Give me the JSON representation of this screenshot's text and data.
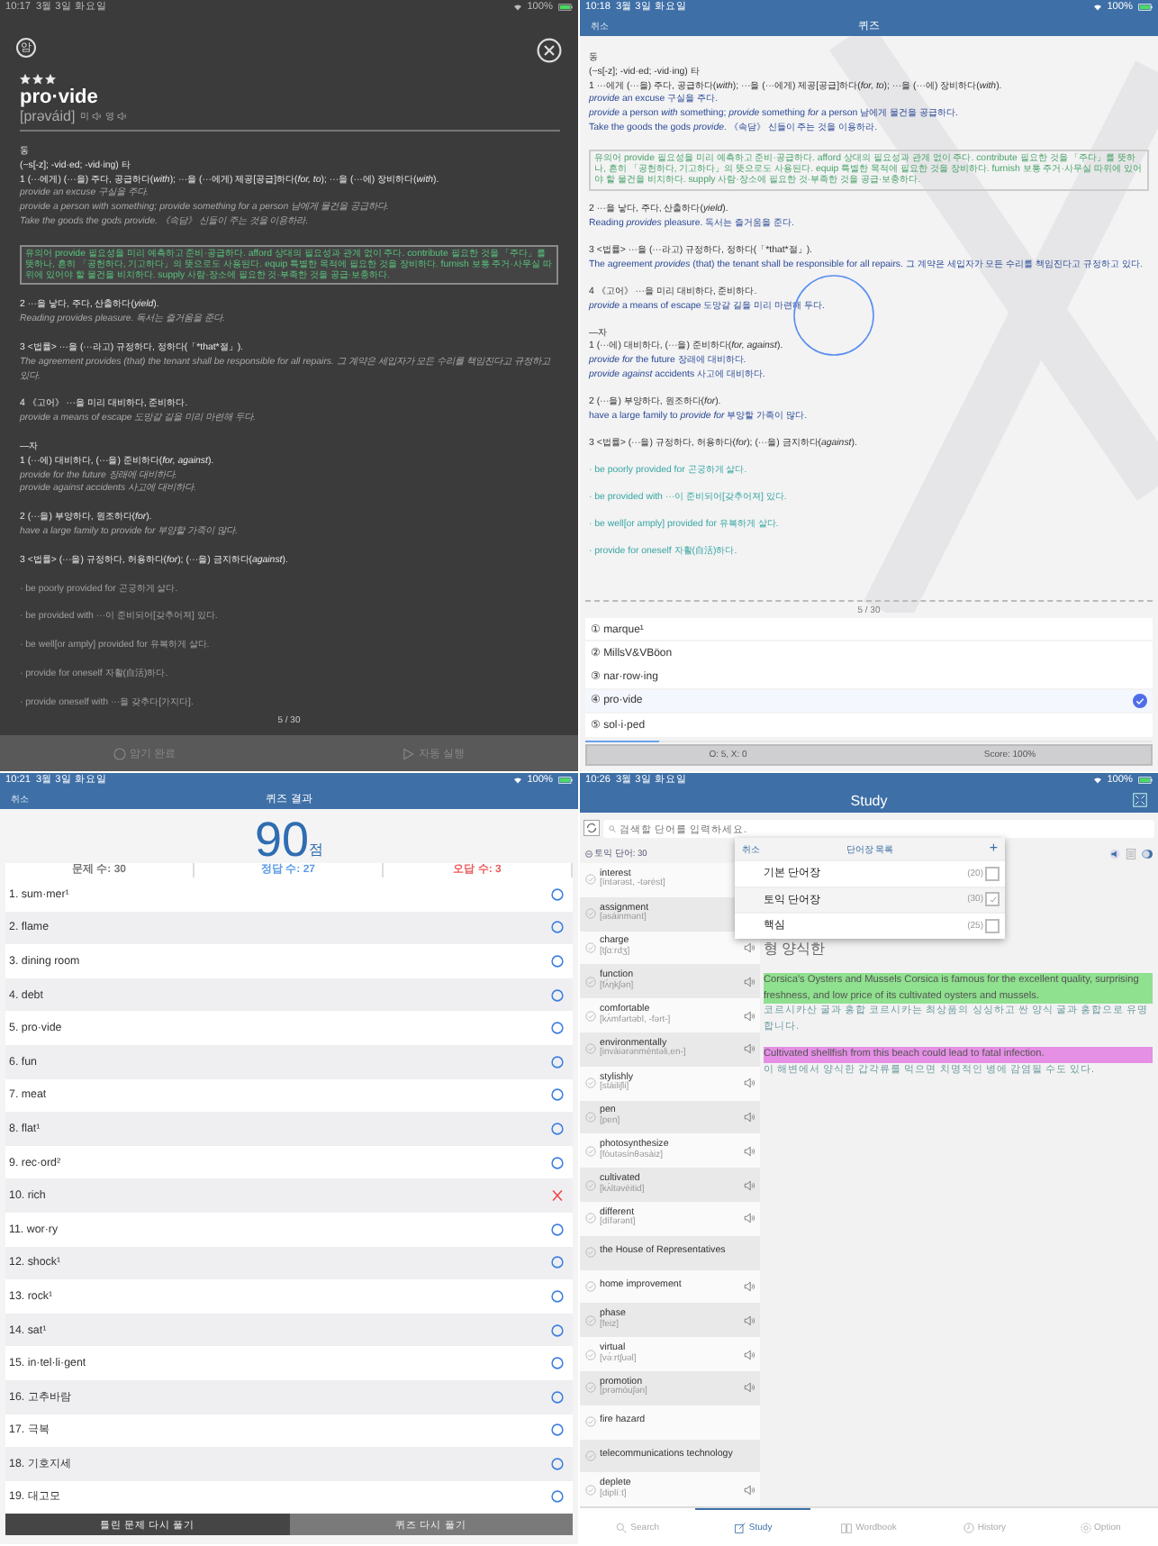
{
  "card": {
    "status_bar": {
      "time": "10:17",
      "date": "3월 3일 화요일",
      "battery": "100%"
    },
    "badge": "암",
    "stars": 3,
    "word": "pro·vide",
    "pronunciation": "[prəváid]",
    "audio": [
      "미",
      "영"
    ],
    "entries": [
      [
        {
          "kind": "pos",
          "text": "동"
        },
        {
          "kind": "pos",
          "text": "(~s[-z]; -vid·ed; -vid·ing) 타"
        },
        {
          "kind": "head",
          "text": "1 (···에게) (···을) 주다, 공급하다(*with*); ···을 (···에게) 제공[공급]하다(*for, to*); ···을 (···에) 장비하다(*with*)."
        },
        {
          "kind": "example",
          "text": "provide an excuse 구실을 주다."
        },
        {
          "kind": "example",
          "text": "provide a person with something; provide something for a person 남에게 물건을 공급하다."
        },
        {
          "kind": "example",
          "text": "Take the goods the gods provide. 《속담》 신들이 주는 것을 이용하라."
        }
      ],
      [
        {
          "kind": "note",
          "text": "유의어 provide 필요성을 미리 예측하고 준비·공급하다. afford 상대의 필요성과 관계 없이 주다. contribute 필요한 것을 「주다」를 뜻하나, 흔히 「공헌하다, 기고하다」의 뜻으로도 사용된다. equip 특별한 목적에 필요한 것을 장비하다. furnish 보통 주거·사무실 따위에 있어야 할 물건을 비치하다. supply 사람·장소에 필요한 것·부족한 것을 공급·보충하다."
        }
      ],
      [
        {
          "kind": "head",
          "text": "2 ···을 낳다, 주다, 산출하다(*yield*)."
        },
        {
          "kind": "example",
          "text": "Reading provides pleasure. 독서는 즐거움을 준다."
        }
      ],
      [
        {
          "kind": "head",
          "text": "3 <법률> ···을 (···라고) 규정하다, 정하다(「*that*절」)."
        },
        {
          "kind": "example",
          "text": "The agreement provides (that) the tenant shall be responsible for all repairs. 그 계약은 세입자가 모든 수리를 책임진다고 규정하고 있다."
        }
      ],
      [
        {
          "kind": "head",
          "text": "4 《고어》 ···을 미리 대비하다, 준비하다."
        },
        {
          "kind": "example",
          "text": "provide a means of escape 도망갈 길을 미리 마련해 두다."
        }
      ],
      [
        {
          "kind": "pos",
          "text": "—자"
        },
        {
          "kind": "head",
          "text": "1 (···에) 대비하다, (···을) 준비하다(*for, against*)."
        },
        {
          "kind": "example",
          "text": "provide for the future 장래에 대비하다."
        },
        {
          "kind": "example",
          "text": "provide against accidents 사고에 대비하다."
        }
      ],
      [
        {
          "kind": "head",
          "text": "2 (···을) 부양하다, 원조하다(*for*)."
        },
        {
          "kind": "example",
          "text": "have a large family to provide for 부양할 가족이 많다."
        }
      ],
      [
        {
          "kind": "head",
          "text": "3 <법률> (···을) 규정하다, 허용하다(*for*); (···을) 금지하다(*against*)."
        }
      ],
      [
        {
          "kind": "phrase",
          "text": "· be poorly provided for 곤궁하게 살다."
        }
      ],
      [
        {
          "kind": "phrase",
          "text": "· be provided with ···이 준비되어[갖추어져] 있다."
        }
      ],
      [
        {
          "kind": "phrase",
          "text": "· be well[or amply] provided for 유복하게 살다."
        }
      ],
      [
        {
          "kind": "phrase",
          "text": "· provide for oneself 자활(自活)하다."
        }
      ],
      [
        {
          "kind": "phrase",
          "text": "· provide oneself with ···을 갖추다[가지다]."
        }
      ]
    ],
    "counter": "5 / 30",
    "actions": [
      "암기 완료",
      "자동 실행"
    ]
  },
  "quiz": {
    "status_bar": {
      "time": "10:18",
      "date": "3월 3일 화요일",
      "battery": "100%"
    },
    "cancel": "취소",
    "title": "퀴즈",
    "entries": [
      [
        {
          "kind": "pos",
          "text": "동"
        },
        {
          "kind": "pos",
          "text": "(~s[-z]; -vid·ed; -vid·ing) 타"
        },
        {
          "kind": "head",
          "text": "1 ···에게 (···을) 주다, 공급하다(*with*); ···을 (···에게) 제공[공급]하다(*for, to*); ···을 (···에) 장비하다(*with*)."
        },
        {
          "kind": "example",
          "text": "*provide* an excuse 구실을 주다."
        },
        {
          "kind": "example",
          "text": "*provide* a person *with* something; *provide* something *for* a person 남에게 물건을 공급하다."
        },
        {
          "kind": "example",
          "text": "Take the goods the gods *provide*. 《속담》 신들이 주는 것을 이용하라."
        }
      ],
      [
        {
          "kind": "note",
          "text": "유의어 provide 필요성을 미리 예측하고 준비·공급하다. afford 상대의 필요성과 관계 없이 주다. contribute 필요한 것을 「주다」를 뜻하나, 흔히 「공헌하다, 기고하다」의 뜻으로도 사용된다. equip 특별한 목적에 필요한 것을 장비하다. furnish 보통 주거·사무실 따위에 있어야 할 물건을 비치하다. supply 사람·장소에 필요한 것·부족한 것을 공급·보충하다."
        }
      ],
      [
        {
          "kind": "head",
          "text": "2 ···을 낳다, 주다, 산출하다(*yield*)."
        },
        {
          "kind": "example",
          "text": "Reading *provides* pleasure. 독서는 즐거움을 준다."
        }
      ],
      [
        {
          "kind": "head",
          "text": "3 <법률> ···을 (···라고) 규정하다, 정하다(「*that*절」)."
        },
        {
          "kind": "example",
          "text": "The agreement *provides* (that) the tenant shall be responsible for all repairs. 그 계약은 세입자가 모든 수리를 책임진다고 규정하고 있다."
        }
      ],
      [
        {
          "kind": "head",
          "text": "4 《고어》 ···을 미리 대비하다, 준비하다."
        },
        {
          "kind": "example",
          "text": "*provide* a means of escape 도망갈 길을 미리 마련해 두다."
        }
      ],
      [
        {
          "kind": "pos",
          "text": "—자"
        },
        {
          "kind": "head",
          "text": "1 (···에) 대비하다, (···을) 준비하다(*for, against*)."
        },
        {
          "kind": "example",
          "text": "*provide for* the future 장래에 대비하다."
        },
        {
          "kind": "example",
          "text": "*provide against* accidents 사고에 대비하다."
        }
      ],
      [
        {
          "kind": "head",
          "text": "2 (···을) 부양하다, 원조하다(*for*)."
        },
        {
          "kind": "example",
          "text": "have a large family to *provide for* 부양할 가족이 많다."
        }
      ],
      [
        {
          "kind": "head",
          "text": "3 <법률> (···을) 규정하다, 허용하다(*for*); (···을) 금지하다(*against*)."
        }
      ],
      [
        {
          "kind": "phrase",
          "text": "· be poorly provided for 곤궁하게 살다."
        }
      ],
      [
        {
          "kind": "phrase",
          "text": "· be provided with ···이 준비되어[갖추어져] 있다."
        }
      ],
      [
        {
          "kind": "phrase",
          "text": "· be well[or amply] provided for 유복하게 살다."
        }
      ],
      [
        {
          "kind": "phrase",
          "text": "· provide for oneself 자활(自活)하다."
        }
      ]
    ],
    "counter": "5 / 30",
    "options": [
      {
        "number": "①",
        "text": "marque¹",
        "selected": false
      },
      {
        "number": "②",
        "text": "MillsV&VBöon",
        "selected": false
      },
      {
        "number": "③",
        "text": "nar·row·ing",
        "selected": false
      },
      {
        "number": "④",
        "text": "pro·vide",
        "selected": true
      },
      {
        "number": "⑤",
        "text": "sol·i·ped",
        "selected": false
      }
    ],
    "progress": {
      "level": 0.13
    },
    "tally": "O: 5, X: 0",
    "score": "Score: 100%"
  },
  "quiz_result": {
    "status_bar": {
      "time": "10:21",
      "date": "3월 3일 화요일",
      "battery": "100%"
    },
    "cancel": "취소",
    "title": "퀴즈 결과",
    "score": "90",
    "score_unit": "점",
    "stats": [
      {
        "text": "문제 수: 30",
        "color": "#777777"
      },
      {
        "text": "정답 수: 27",
        "color": "#5b9be6"
      },
      {
        "text": "오답 수: 3",
        "color": "#ec5b5b"
      }
    ],
    "items": [
      {
        "text": "1. sum·mer¹",
        "correct": true
      },
      {
        "text": "2. flame",
        "correct": true
      },
      {
        "text": "3. dining room",
        "correct": true
      },
      {
        "text": "4. debt",
        "correct": true
      },
      {
        "text": "5. pro·vide",
        "correct": true
      },
      {
        "text": "6. fun",
        "correct": true
      },
      {
        "text": "7. meat",
        "correct": true
      },
      {
        "text": "8. flat¹",
        "correct": true
      },
      {
        "text": "9. rec·ord²",
        "correct": true
      },
      {
        "text": "10. rich",
        "correct": false
      },
      {
        "text": "11. wor·ry",
        "correct": true
      },
      {
        "text": "12. shock¹",
        "correct": true
      },
      {
        "text": "13. rock¹",
        "correct": true
      },
      {
        "text": "14. sat¹",
        "correct": true
      },
      {
        "text": "15. in·tel·li·gent",
        "correct": true
      },
      {
        "text": "16. 고추바람",
        "correct": true
      },
      {
        "text": "17. 극복",
        "correct": true
      },
      {
        "text": "18. 기호지세",
        "correct": true
      },
      {
        "text": "19. 대고모",
        "correct": true
      }
    ],
    "buttons": [
      "틀린 문제 다시 풀기",
      "퀴즈 다시 풀기"
    ]
  },
  "study": {
    "status_bar": {
      "time": "10:26",
      "date": "3월 3일 화요일",
      "battery": "100%"
    },
    "title": "Study",
    "search": {
      "placeholder": "검색할 단어를 입력하세요."
    },
    "list_title": "토익 단어: 30",
    "words": [
      {
        "word": "interest",
        "pronunciation": "[íntərəst, -tərèst]",
        "audio": false
      },
      {
        "word": "assignment",
        "pronunciation": "[əsáinmənt]",
        "audio": false
      },
      {
        "word": "charge",
        "pronunciation": "[tʃɑːrdʒ]",
        "audio": true
      },
      {
        "word": "function",
        "pronunciation": "[fʌ́ŋkʃən]",
        "audio": true
      },
      {
        "word": "comfortable",
        "pronunciation": "[kʌ́mfərtəbl, -fərt-]",
        "audio": true
      },
      {
        "word": "environmentally",
        "pronunciation": "[invàiərənméntəli,en-]",
        "audio": true
      },
      {
        "word": "stylishly",
        "pronunciation": "[stáiliʃli]",
        "audio": true
      },
      {
        "word": "pen",
        "pronunciation": "[pen]",
        "audio": true
      },
      {
        "word": "photosynthesize",
        "pronunciation": "[fòutəsínθəsàiz]",
        "audio": true
      },
      {
        "word": "cultivated",
        "pronunciation": "[kʌ́ltəvèitid]",
        "audio": true
      },
      {
        "word": "different",
        "pronunciation": "[dífərənt]",
        "audio": true
      },
      {
        "word": "the House of Representatives",
        "audio": false
      },
      {
        "word": "home improvement",
        "audio": true
      },
      {
        "word": "phase",
        "pronunciation": "[feiz]",
        "audio": true
      },
      {
        "word": "virtual",
        "pronunciation": "[və́ːrtʃuəl]",
        "audio": true
      },
      {
        "word": "promotion",
        "pronunciation": "[prəmóuʃən]",
        "audio": true
      },
      {
        "word": "fire hazard",
        "audio": false
      },
      {
        "word": "telecommunications technology",
        "audio": false
      },
      {
        "word": "deplete",
        "pronunciation": "[diplíːt]",
        "audio": true
      }
    ],
    "meaning": "형 양식한",
    "sentences": [
      {
        "text": "Corsica's Oysters and Mussels Corsica is famous for the excellent quality, surprising freshness, and low price of its cultivated oysters and mussels.",
        "color": "#8fe08f",
        "translation": "코르시카산 굴과 홍합 코르시카는 최상품의 싱싱하고 싼 양식 굴과 홍합으로 유명합니다."
      },
      {
        "text": "Cultivated shellfish from this beach could lead to fatal infection.",
        "color": "#e58fe5",
        "translation": "이 해변에서 양식한 갑각류를 먹으면 치명적인 병에 감염될 수도 있다."
      }
    ],
    "popup": {
      "cancel": "취소",
      "title": "단어장 목록",
      "add": "+",
      "lists": [
        {
          "name": "기본 단어장",
          "count": "(20)",
          "checked": false
        },
        {
          "name": "토익 단어장",
          "count": "(30)",
          "checked": true
        },
        {
          "name": "핵심",
          "count": "(25)",
          "checked": false
        }
      ]
    },
    "tabs": [
      {
        "label": "Search",
        "selected": false
      },
      {
        "label": "Study",
        "selected": true
      },
      {
        "label": "Wordbook",
        "selected": false
      },
      {
        "label": "History",
        "selected": false
      },
      {
        "label": "Option",
        "selected": false
      }
    ]
  }
}
